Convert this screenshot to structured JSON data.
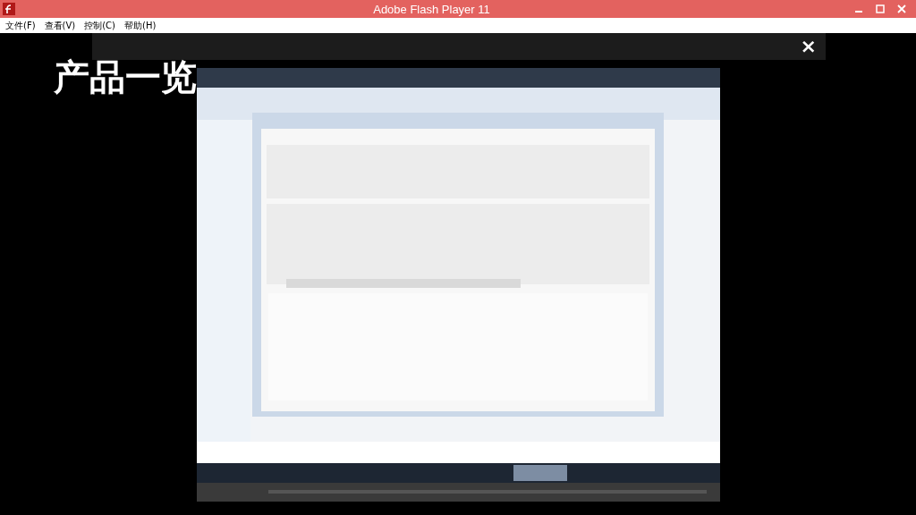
{
  "window": {
    "title": "Adobe Flash Player 11"
  },
  "menu": [
    "文件(F)",
    "查看(V)",
    "控制(C)",
    "帮助(H)"
  ],
  "overlay": {
    "close": "×"
  },
  "slide": {
    "title": "产品一览"
  }
}
